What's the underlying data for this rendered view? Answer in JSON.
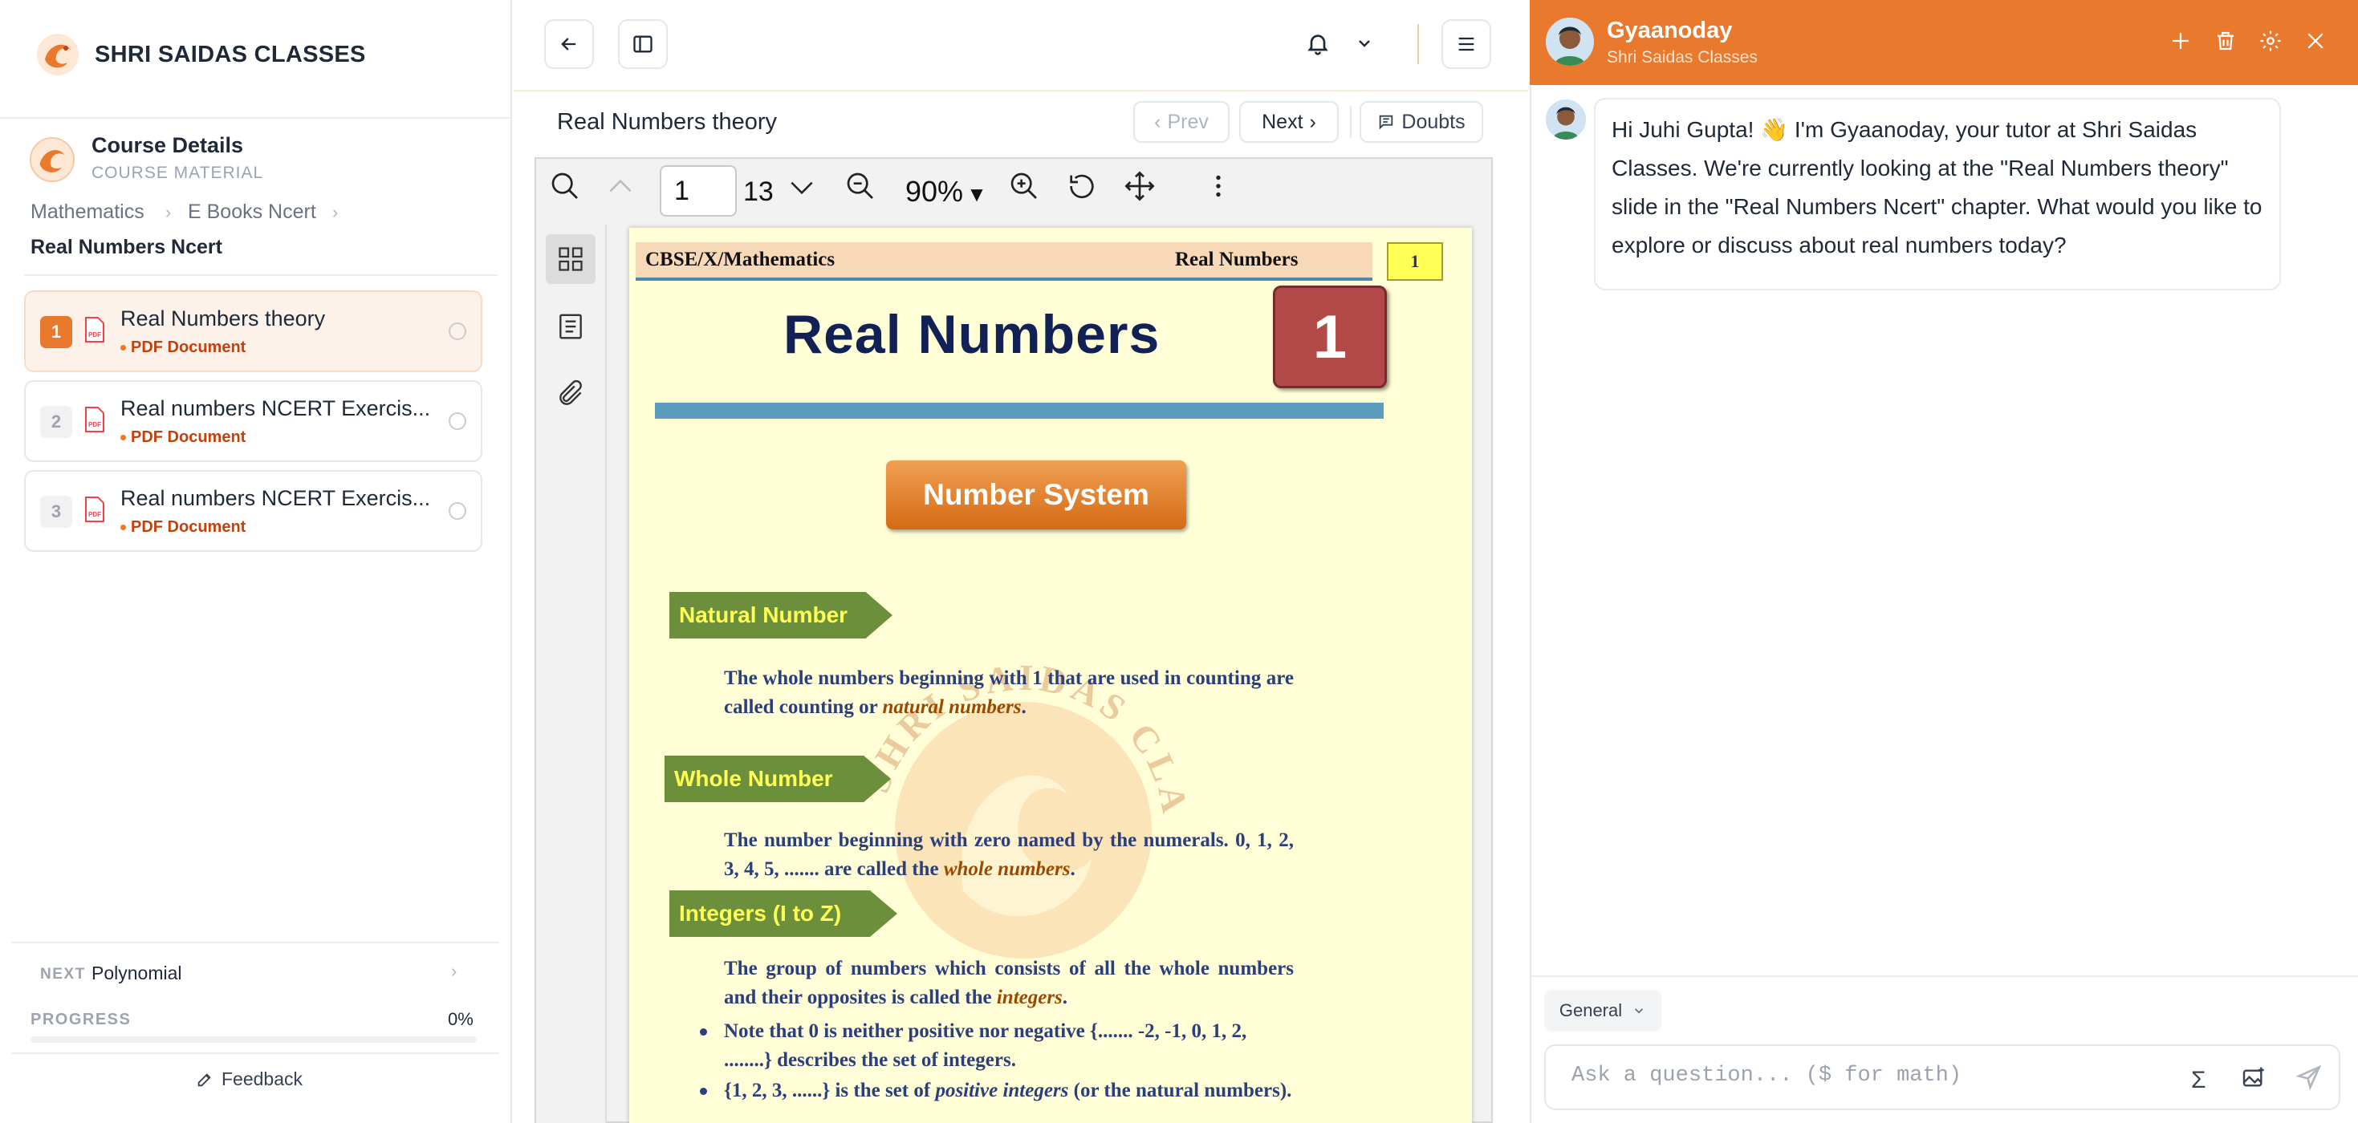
{
  "sidebar": {
    "brand": "SHRI SAIDAS CLASSES",
    "course_title": "Course Details",
    "course_sub": "COURSE MATERIAL",
    "breadcrumb": [
      "Mathematics",
      "E Books Ncert"
    ],
    "breadcrumb_current": "Real Numbers Ncert",
    "items": [
      {
        "num": "1",
        "title": "Real Numbers theory",
        "type": "PDF Document"
      },
      {
        "num": "2",
        "title": "Real numbers NCERT Exercis...",
        "type": "PDF Document"
      },
      {
        "num": "3",
        "title": "Real numbers NCERT Exercis...",
        "type": "PDF Document"
      }
    ],
    "next_label": "NEXT",
    "next_value": "Polynomial",
    "progress_label": "PROGRESS",
    "progress_text": "0%",
    "progress_value": 0,
    "feedback": "Feedback"
  },
  "viewer": {
    "doc_title": "Real Numbers theory",
    "prev": "Prev",
    "next": "Next",
    "doubts": "Doubts",
    "page_input": "1",
    "page_total": "13",
    "zoom": "90%"
  },
  "page": {
    "header_left": "CBSE/X/Mathematics",
    "header_right": "Real Numbers",
    "header_num": "1",
    "title": "Real Numbers",
    "chapter_num": "1",
    "section": "Number System",
    "tag1": "Natural Number",
    "p1a": "The whole numbers beginning with 1 that are used in counting are called counting or ",
    "p1b": "natural numbers",
    "p1c": ".",
    "tag2": "Whole Number",
    "p2a": "The number beginning with zero named by the numerals. 0, 1, 2, 3, 4, 5, ....... are called the ",
    "p2b": "whole numbers",
    "p2c": ".",
    "tag3": "Integers (I to Z)",
    "p3a": "The group of numbers which consists of all the whole numbers and their opposites is called the ",
    "p3b": "integers",
    "p3c": ".",
    "b1": "Note that 0 is neither positive nor negative {....... -2, -1, 0, 1, 2, ........} describes the set of integers.",
    "b2a": "{1, 2, 3, ......} is the set of ",
    "b2b": "positive integers",
    "b2c": " (or the natural numbers)."
  },
  "tutor": {
    "name": "Gyaanoday",
    "sub": "Shri Saidas Classes",
    "message": "Hi Juhi Gupta! 👋 I'm Gyaanoday, your tutor at Shri Saidas Classes. We're currently looking at the \"Real Numbers theory\" slide in the \"Real Numbers Ncert\" chapter. What would you like to explore or discuss about real numbers today?",
    "mode": "General",
    "placeholder": "Ask a question... ($ for math)"
  },
  "colors": {
    "accent": "#e8792d",
    "header_band": "#f7d9b8",
    "page_bg": "#fffed7",
    "tag_green": "#6b8f3a"
  }
}
